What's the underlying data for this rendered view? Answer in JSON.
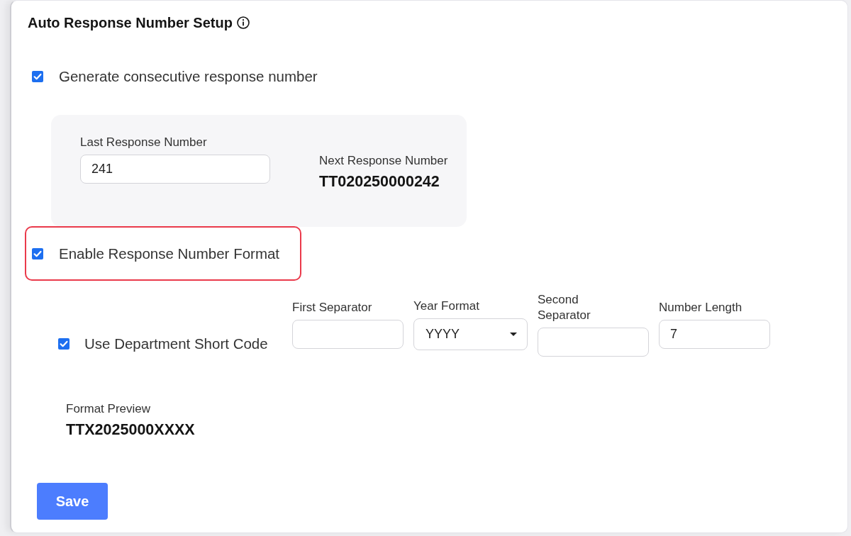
{
  "section": {
    "title": "Auto Response Number Setup"
  },
  "consecutive": {
    "label": "Generate consecutive response number",
    "checked": true,
    "highlighted": false
  },
  "number_panel": {
    "last_field": {
      "label": "Last Response Number",
      "value": "241"
    },
    "next": {
      "label": "Next Response Number",
      "value": "TT020250000242"
    }
  },
  "format_toggle": {
    "label": "Enable Response Number Format",
    "checked": true,
    "highlighted": true
  },
  "format_options": {
    "department_code": {
      "label": "Use Department Short Code",
      "checked": true
    },
    "fields": [
      {
        "kind": "text",
        "label": "First Separator"
      },
      {
        "kind": "select",
        "label": "Year Format",
        "value": "YYYY"
      },
      {
        "kind": "text",
        "label": "Second Separator"
      },
      {
        "kind": "text",
        "label": "Number Length",
        "value": "7"
      }
    ]
  },
  "preview": {
    "label": "Format Preview",
    "value": "TTX2025000XXXX"
  },
  "buttons": [
    {
      "label": "Save"
    }
  ]
}
